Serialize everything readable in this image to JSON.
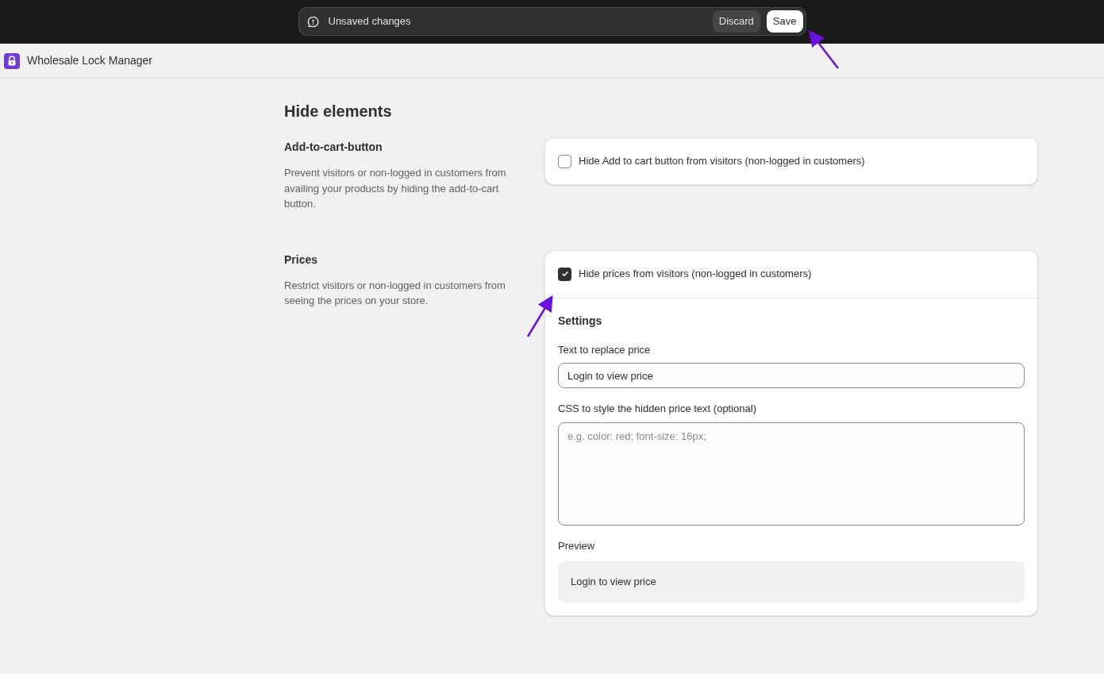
{
  "save_bar": {
    "message": "Unsaved changes",
    "buttons": [
      {
        "kind": "secondary",
        "label": "Discard"
      },
      {
        "kind": "primary",
        "label": "Save"
      }
    ]
  },
  "app": {
    "title": "Wholesale Lock Manager"
  },
  "page": {
    "title": "Hide elements"
  },
  "sections": [
    {
      "title": "Add-to-cart-button",
      "description": "Prevent visitors or non-logged in customers from availing your products by hiding the add-to-cart button.",
      "option": {
        "label": "Hide Add to cart button from visitors (non-logged in customers)",
        "checked": false
      }
    },
    {
      "title": "Prices",
      "description": "Restrict visitors or non-logged in customers from seeing the prices on your store.",
      "option": {
        "label": "Hide prices from visitors (non-logged in customers)",
        "checked": true
      },
      "settings": {
        "title": "Settings",
        "replace_text": {
          "label": "Text to replace price",
          "value": "Login to view price"
        },
        "css": {
          "label": "CSS to style the hidden price text (optional)",
          "placeholder": "e.g. color: red; font-size: 16px;"
        },
        "preview": {
          "label": "Preview",
          "text": "Login to view price"
        }
      }
    }
  ]
}
